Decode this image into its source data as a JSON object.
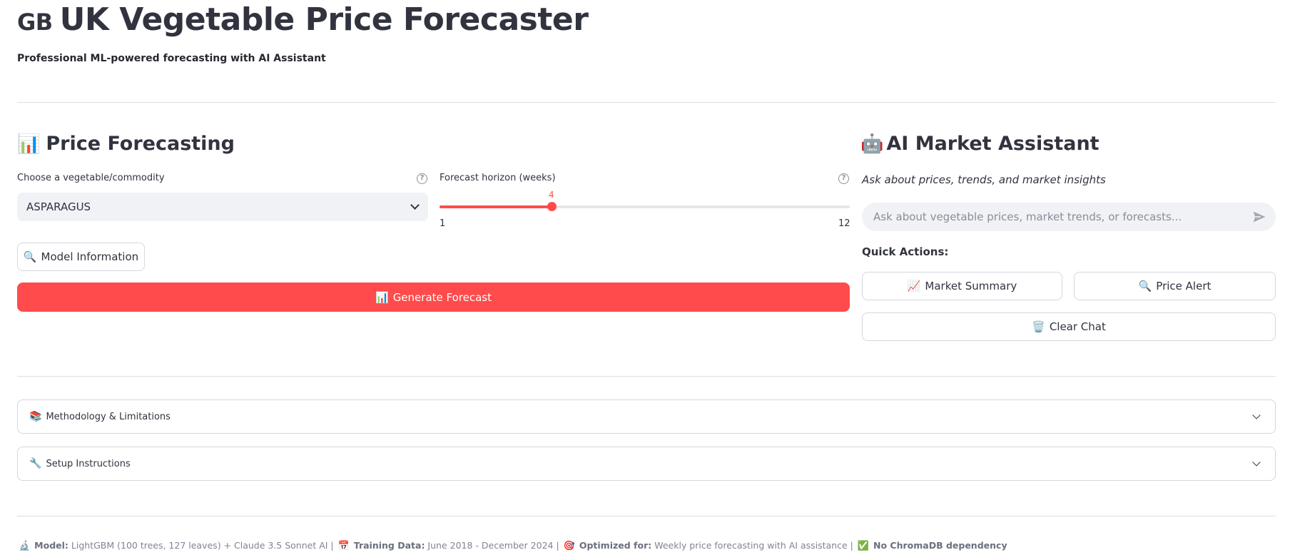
{
  "header": {
    "flag": "GB",
    "title": "UK Vegetable Price Forecaster",
    "subtitle": "Professional ML-powered forecasting with AI Assistant"
  },
  "forecast": {
    "heading_icon": "📊",
    "heading": "Price Forecasting",
    "select_label": "Choose a vegetable/commodity",
    "select_value": "ASPARAGUS",
    "slider_label": "Forecast horizon (weeks)",
    "slider_value": "4",
    "slider_min": "1",
    "slider_max": "12",
    "slider_fraction": 0.2727,
    "model_info_icon": "🔍",
    "model_info_label": "Model Information",
    "generate_icon": "📊",
    "generate_label": "Generate Forecast"
  },
  "assistant": {
    "heading_icon": "🤖",
    "heading": "AI Market Assistant",
    "caption": "Ask about prices, trends, and market insights",
    "input_placeholder": "Ask about vegetable prices, market trends, or forecasts...",
    "quick_actions_label": "Quick Actions:",
    "market_summary_icon": "📈",
    "market_summary_label": "Market Summary",
    "price_alert_icon": "🔍",
    "price_alert_label": "Price Alert",
    "clear_chat_icon": "🗑️",
    "clear_chat_label": "Clear Chat"
  },
  "expanders": [
    {
      "icon": "📚",
      "label": "Methodology & Limitations"
    },
    {
      "icon": "🔧",
      "label": "Setup Instructions"
    }
  ],
  "footer": {
    "model_icon": "🔬",
    "model_key": "Model:",
    "model_val": "LightGBM (100 trees, 127 leaves) + Claude 3.5 Sonnet AI |",
    "training_icon": "📅",
    "training_key": "Training Data:",
    "training_val": "June 2018 - December 2024 |",
    "optimized_icon": "🎯",
    "optimized_key": "Optimized for:",
    "optimized_val": "Weekly price forecasting with AI assistance |",
    "chroma_icon": "✅",
    "chroma_text": "No ChromaDB dependency"
  },
  "colors": {
    "accent": "#ff4b4b",
    "text": "#31333f",
    "input_bg": "#f0f2f6",
    "border": "#d5d7de"
  }
}
